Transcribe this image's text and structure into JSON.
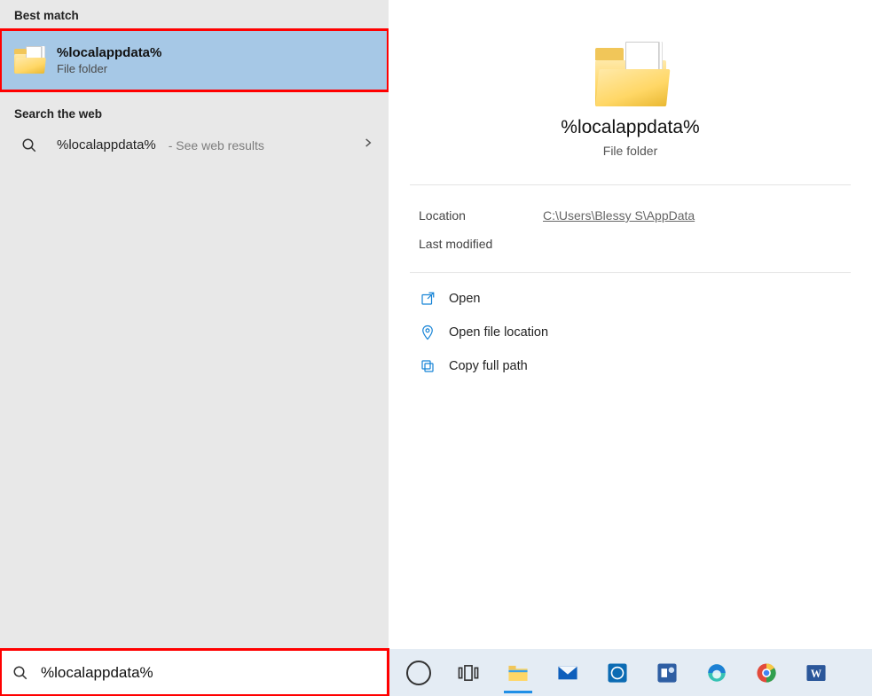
{
  "left": {
    "best_match_header": "Best match",
    "result": {
      "title": "%localappdata%",
      "subtitle": "File folder"
    },
    "web_header": "Search the web",
    "web": {
      "query": "%localappdata%",
      "hint": "- See web results"
    }
  },
  "preview": {
    "title": "%localappdata%",
    "subtitle": "File folder",
    "location_label": "Location",
    "location_value": "C:\\Users\\Blessy S\\AppData",
    "modified_label": "Last modified",
    "actions": {
      "open": "Open",
      "open_location": "Open file location",
      "copy_path": "Copy full path"
    }
  },
  "search_input": "%localappdata%"
}
